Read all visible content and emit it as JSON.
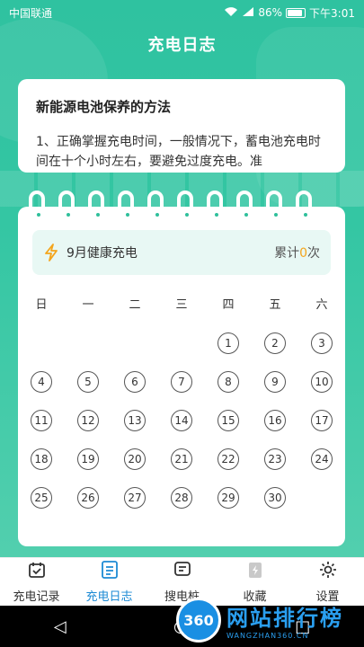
{
  "status_bar": {
    "carrier": "中国联通",
    "battery": "86%",
    "time": "下午3:01"
  },
  "header": {
    "title": "充电日志"
  },
  "article": {
    "title": "新能源电池保养的方法",
    "body": "1、正确掌握充电时间，一般情况下，蓄电池充电时间在十个小时左右，要避免过度充电。准"
  },
  "calendar": {
    "month_label": "9月健康充电",
    "total_prefix": "累计",
    "total_count": "0",
    "total_suffix": "次",
    "weekdays": [
      "日",
      "一",
      "二",
      "三",
      "四",
      "五",
      "六"
    ],
    "first_weekday_index": 4,
    "days": [
      "1",
      "2",
      "3",
      "4",
      "5",
      "6",
      "7",
      "8",
      "9",
      "10",
      "11",
      "12",
      "13",
      "14",
      "15",
      "16",
      "17",
      "18",
      "19",
      "20",
      "21",
      "22",
      "23",
      "24",
      "25",
      "26",
      "27",
      "28",
      "29",
      "30"
    ],
    "accent_color": "#f4a51c"
  },
  "tabs": [
    {
      "label": "充电记录",
      "icon": "calendar-icon",
      "active": false
    },
    {
      "label": "充电日志",
      "icon": "document-icon",
      "active": true
    },
    {
      "label": "搜电桩",
      "icon": "chat-doc-icon",
      "active": false
    },
    {
      "label": "收藏",
      "icon": "battery-bolt-icon",
      "active": false
    },
    {
      "label": "设置",
      "icon": "gear-icon",
      "active": false
    }
  ],
  "watermark": {
    "logo": "360",
    "text": "网站排行榜",
    "subtext": "WANGZHAN360.CN"
  },
  "colors": {
    "primary": "#2fbf9b",
    "active_tab": "#1c8ad4"
  }
}
